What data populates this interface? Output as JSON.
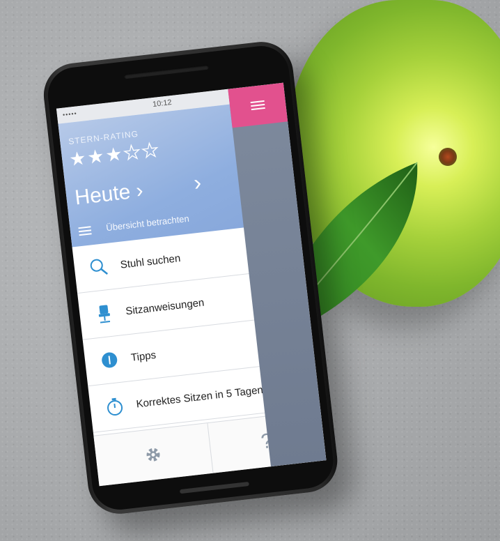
{
  "status": {
    "dots": "•••••",
    "time": "10:12"
  },
  "header": {
    "rating_label": "STERN-RATING",
    "stars_filled": 3,
    "stars_total": 5,
    "day": "Heute",
    "overview": "Übersicht betrachten"
  },
  "menu": {
    "items": [
      {
        "label": "Stuhl suchen",
        "icon": "search-icon"
      },
      {
        "label": "Sitzanweisungen",
        "icon": "chair-icon"
      },
      {
        "label": "Tipps",
        "icon": "tip-icon"
      },
      {
        "label": "Korrektes Sitzen in 5 Tagen",
        "icon": "stopwatch-icon"
      }
    ]
  },
  "footer": {
    "help": "?"
  },
  "colors": {
    "header": "#8eaedf",
    "accent": "#e2518e",
    "sidebar": "#7e8a9d"
  }
}
